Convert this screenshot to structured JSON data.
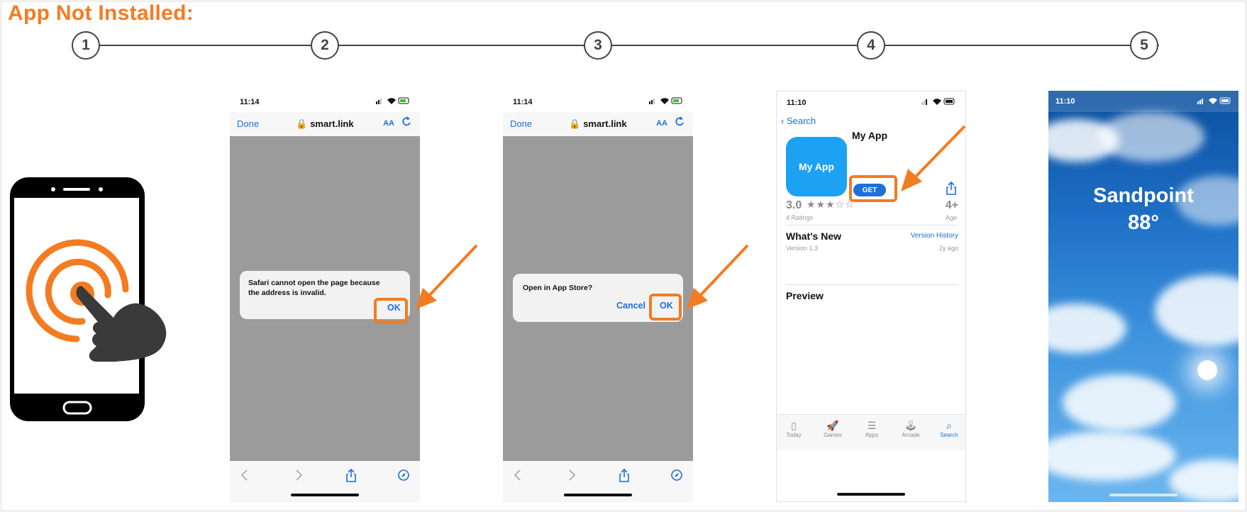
{
  "title": "App Not Installed:",
  "steps": [
    "1",
    "2",
    "3",
    "4",
    "5"
  ],
  "colors": {
    "accent": "#f47b20",
    "ios_blue": "#1e6fd9",
    "dark": "#444444"
  },
  "step2": {
    "time": "11:14",
    "done": "Done",
    "url": "smart.link",
    "text_size": "AA",
    "dialog_text": "Safari cannot open the page because the address is invalid.",
    "ok": "OK"
  },
  "step3": {
    "time": "11:14",
    "done": "Done",
    "url": "smart.link",
    "text_size": "AA",
    "dialog_text": "Open in App Store?",
    "cancel": "Cancel",
    "ok": "OK"
  },
  "step4": {
    "time": "11:10",
    "back": "Search",
    "icon_text": "My App",
    "app_name": "My App",
    "get": "GET",
    "rating": "3.0",
    "stars": "★★★☆☆",
    "ratings_count": "4 Ratings",
    "age": "4+",
    "age_label": "Age",
    "whats_new": "What's New",
    "version_history": "Version History",
    "version": "Version 1.3",
    "version_age": "2y ago",
    "preview": "Preview",
    "tabs": [
      "Today",
      "Games",
      "Apps",
      "Arcade",
      "Search"
    ]
  },
  "step5": {
    "time": "11:10",
    "city": "Sandpoint",
    "temp": "88°"
  }
}
